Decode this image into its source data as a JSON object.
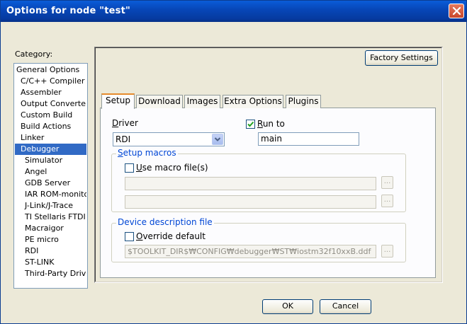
{
  "window": {
    "title": "Options for node \"test\"",
    "close_icon": "close-icon"
  },
  "category": {
    "label": "Category:",
    "items": [
      {
        "label": "General Options",
        "indent": false,
        "selected": false
      },
      {
        "label": "C/C++ Compiler",
        "indent": true,
        "selected": false
      },
      {
        "label": "Assembler",
        "indent": true,
        "selected": false
      },
      {
        "label": "Output Converter",
        "indent": true,
        "selected": false
      },
      {
        "label": "Custom Build",
        "indent": true,
        "selected": false
      },
      {
        "label": "Build Actions",
        "indent": true,
        "selected": false
      },
      {
        "label": "Linker",
        "indent": true,
        "selected": false
      },
      {
        "label": "Debugger",
        "indent": true,
        "selected": true
      },
      {
        "label": "Simulator",
        "indent": true,
        "selected": false
      },
      {
        "label": "Angel",
        "indent": true,
        "selected": false
      },
      {
        "label": "GDB Server",
        "indent": true,
        "selected": false
      },
      {
        "label": "IAR ROM-monitor",
        "indent": true,
        "selected": false
      },
      {
        "label": "J-Link/J-Trace",
        "indent": true,
        "selected": false
      },
      {
        "label": "TI Stellaris FTDI",
        "indent": true,
        "selected": false
      },
      {
        "label": "Macraigor",
        "indent": true,
        "selected": false
      },
      {
        "label": "PE micro",
        "indent": true,
        "selected": false
      },
      {
        "label": "RDI",
        "indent": true,
        "selected": false
      },
      {
        "label": "ST-LINK",
        "indent": true,
        "selected": false
      },
      {
        "label": "Third-Party Driver",
        "indent": true,
        "selected": false
      }
    ]
  },
  "factory_settings_label": "Factory Settings",
  "tabs": [
    {
      "label": "Setup",
      "active": true
    },
    {
      "label": "Download",
      "active": false
    },
    {
      "label": "Images",
      "active": false
    },
    {
      "label": "Extra Options",
      "active": false
    },
    {
      "label": "Plugins",
      "active": false
    }
  ],
  "setup": {
    "driver_label_u": "D",
    "driver_label_rest": "river",
    "driver_value": "RDI",
    "run_to_u": "R",
    "run_to_rest": "un to",
    "run_to_checked": true,
    "run_to_value": "main",
    "macros_legend_u": "S",
    "macros_legend_rest": "etup macros",
    "use_macro_u": "U",
    "use_macro_rest": "se macro file(s)",
    "use_macro_checked": false,
    "macro_file_1": "",
    "macro_file_2": "",
    "ellipsis": "...",
    "device_legend": "Device description file",
    "override_u": "O",
    "override_rest": "verride default",
    "override_checked": false,
    "device_file": "$TOOLKIT_DIR$₩CONFIG₩debugger₩ST₩iostm32f10xxB.ddf"
  },
  "buttons": {
    "ok": "OK",
    "cancel": "Cancel"
  },
  "colors": {
    "titlebar": "#0747b8",
    "selection": "#316ac5",
    "group_legend": "#0046d5",
    "active_tab_accent": "#e68b2c"
  }
}
